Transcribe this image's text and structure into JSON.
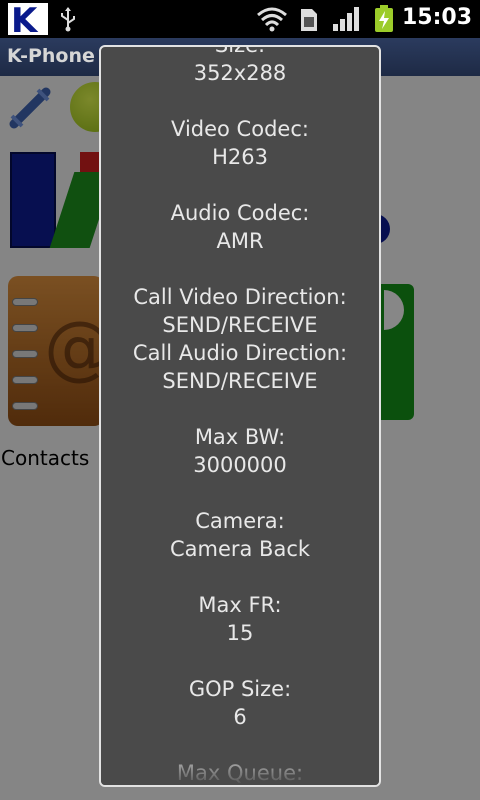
{
  "status_bar": {
    "app_icon": "k-phone-logo-icon",
    "app_icon_letter": "K",
    "icons": [
      "usb-icon",
      "wifi-icon",
      "sim-icon",
      "signal-icon",
      "battery-charging-icon"
    ],
    "time": "15:03"
  },
  "app": {
    "title": "K-Phone",
    "contacts_label": "Contacts"
  },
  "dialog": {
    "lines": [
      "Size:",
      "352x288",
      "",
      "Video Codec:",
      "H263",
      "",
      "Audio Codec:",
      "AMR",
      "",
      "Call Video Direction:",
      "SEND/RECEIVE",
      "Call Audio Direction:",
      "SEND/RECEIVE",
      "",
      "Max BW:",
      "3000000",
      "",
      "Camera:",
      "Camera Back",
      "",
      "Max FR:",
      "15",
      "",
      "GOP Size:",
      "6",
      "",
      "Max Queue:"
    ]
  },
  "colors": {
    "dialog_background": "#4a4a4a",
    "dialog_text": "#e8e8e8",
    "title_bar": "#2b3b5e"
  }
}
